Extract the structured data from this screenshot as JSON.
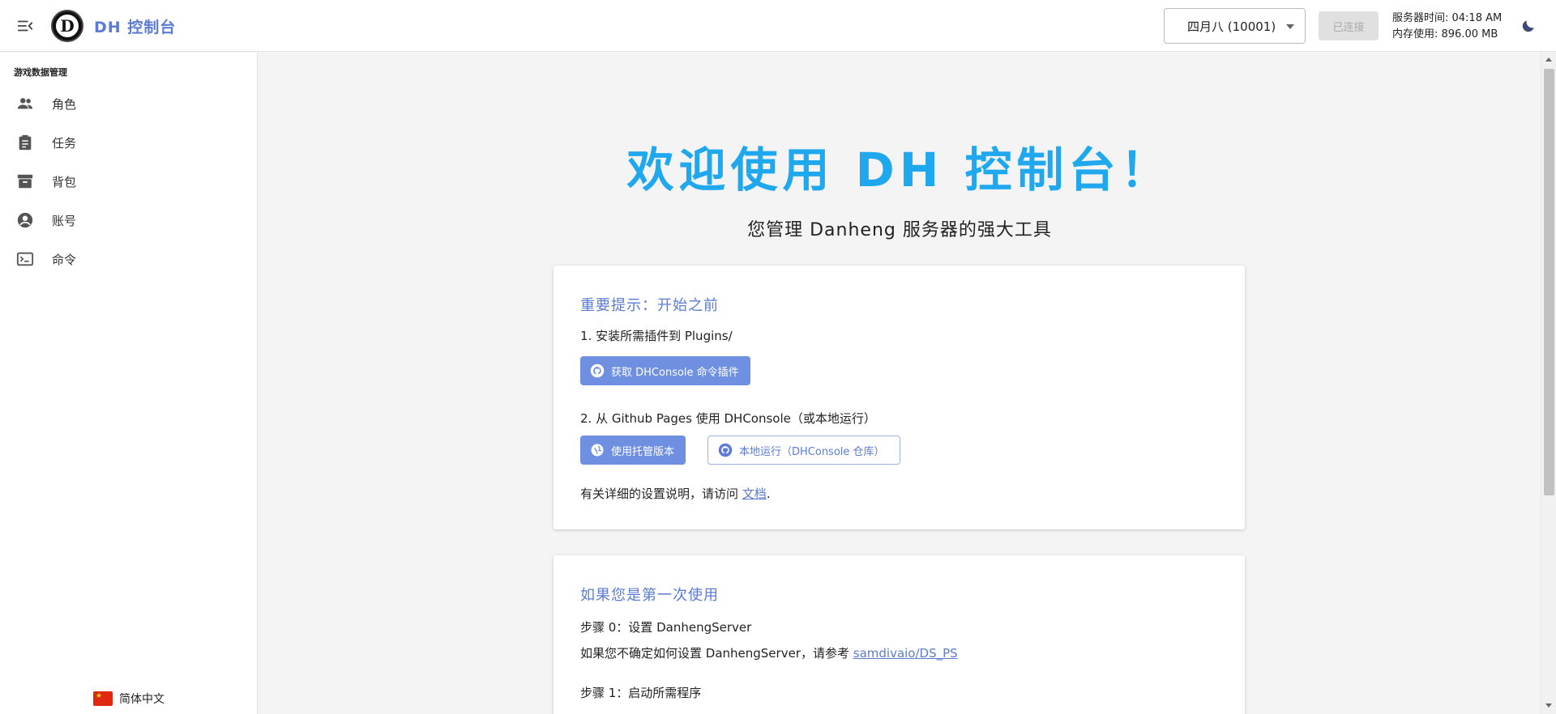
{
  "header": {
    "title": "DH 控制台",
    "logo_letter": "D",
    "server_select": "四月八 (10001)",
    "connect_status": "已连接",
    "server_time": "服务器时间: 04:18 AM",
    "memory": "内存使用: 896.00 MB"
  },
  "sidebar": {
    "section": "游戏数据管理",
    "items": [
      {
        "label": "角色",
        "icon": "people-icon"
      },
      {
        "label": "任务",
        "icon": "clipboard-icon"
      },
      {
        "label": "背包",
        "icon": "archive-icon"
      },
      {
        "label": "账号",
        "icon": "account-circle-icon"
      },
      {
        "label": "命令",
        "icon": "terminal-icon"
      }
    ],
    "language": "简体中文"
  },
  "main": {
    "welcome": "欢迎使用 DH 控制台！",
    "subtitle": "您管理 Danheng 服务器的强大工具",
    "card1": {
      "title": "重要提示：开始之前",
      "step1": "1. 安装所需插件到 Plugins/",
      "plugin_button": "获取 DHConsole 命令插件",
      "step2": "2. 从 Github Pages 使用 DHConsole（或本地运行）",
      "hosted_button": "使用托管版本",
      "local_button": "本地运行（DHConsole 仓库）",
      "docs_prefix": "有关详细的设置说明，请访问",
      "docs_link": "文档",
      "docs_suffix": "."
    },
    "card2": {
      "title": "如果您是第一次使用",
      "step0": "步骤 0：设置 DanhengServer",
      "step0_desc": "如果您不确定如何设置 DanhengServer，请参考",
      "step0_link": "samdivaio/DS_PS",
      "step1": "步骤 1：启动所需程序"
    }
  },
  "colors": {
    "accent": "#5b7bd5",
    "welcome": "#1fa8ee",
    "button": "#6f8fe0"
  }
}
